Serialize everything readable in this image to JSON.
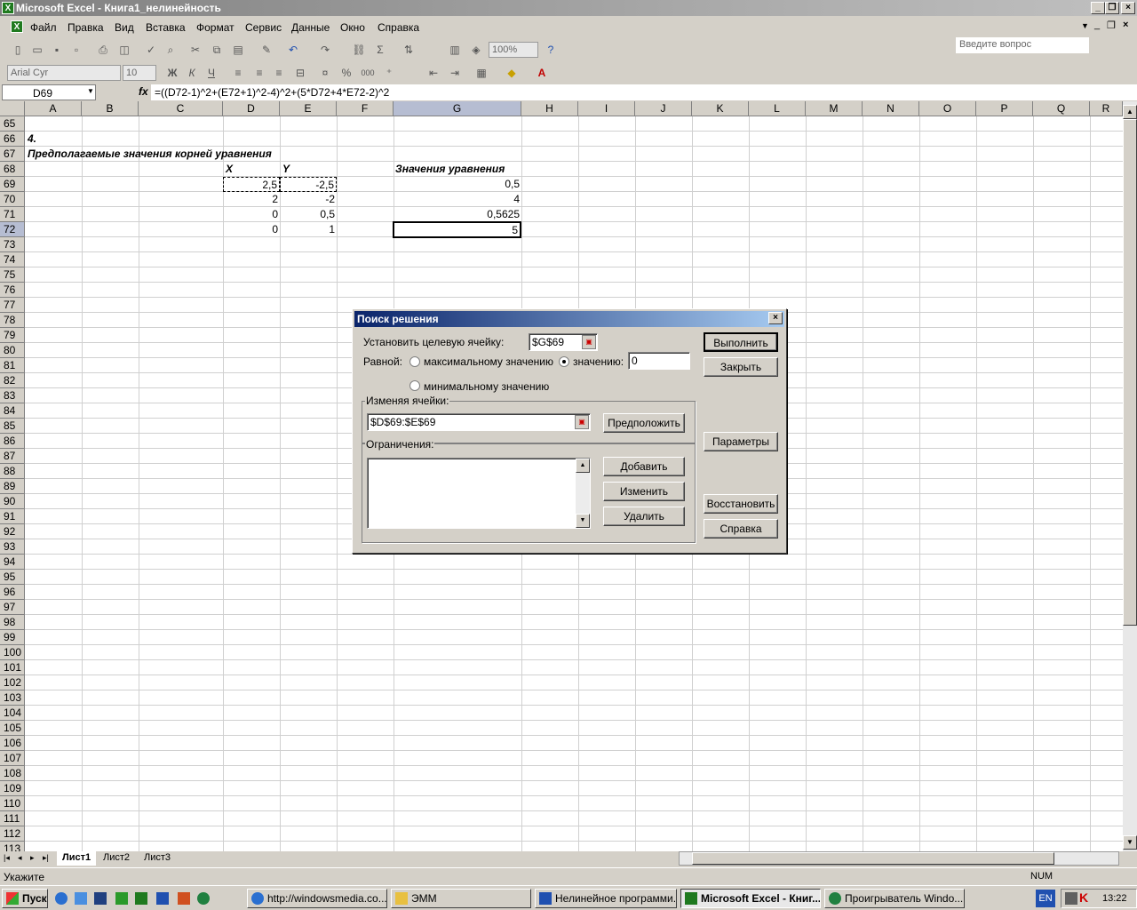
{
  "window": {
    "title": "Microsoft Excel - Книга1_нелинейность",
    "app_icon": "X"
  },
  "menu": {
    "items": [
      "Файл",
      "Правка",
      "Вид",
      "Вставка",
      "Формат",
      "Сервис",
      "Данные",
      "Окно",
      "Справка"
    ],
    "help_placeholder": "Введите вопрос"
  },
  "toolbar": {
    "zoom": "100%",
    "font_name": "Arial Cyr",
    "font_size": "10",
    "bold": "Ж",
    "italic": "К",
    "underline": "Ч"
  },
  "formula_bar": {
    "name_box": "D69",
    "fx": "fx",
    "formula": "=((D72-1)^2+(E72+1)^2-4)^2+(5*D72+4*E72-2)^2"
  },
  "columns": [
    "A",
    "B",
    "C",
    "D",
    "E",
    "F",
    "G",
    "H",
    "I",
    "J",
    "K",
    "L",
    "M",
    "N",
    "O",
    "P",
    "Q",
    "R"
  ],
  "rows": [
    "65",
    "66",
    "67",
    "68",
    "69",
    "70",
    "71",
    "72",
    "73",
    "74",
    "75",
    "76",
    "77",
    "78",
    "79",
    "80",
    "81",
    "82",
    "83",
    "84",
    "85",
    "86",
    "87",
    "88",
    "89",
    "90",
    "91",
    "92",
    "93",
    "94",
    "95",
    "96",
    "97",
    "98",
    "99",
    "100",
    "101",
    "102",
    "103",
    "104",
    "105",
    "106",
    "107",
    "108",
    "109",
    "110",
    "111",
    "112",
    "113"
  ],
  "cells": {
    "a66": "4.",
    "a67": "Предполагаемые значения корней уравнения",
    "d68": "X",
    "e68": "Y",
    "g68": "Значения уравнения",
    "d69": "2,5",
    "e69": "-2,5",
    "g69": "0,5",
    "d70": "2",
    "e70": "-2",
    "g70": "4",
    "d71": "0",
    "e71": "0,5",
    "g71": "0,5625",
    "d72": "0",
    "e72": "1",
    "g72": "5"
  },
  "sheets": [
    "Лист1",
    "Лист2",
    "Лист3"
  ],
  "status": {
    "mode": "Укажите",
    "num": "NUM"
  },
  "dialog": {
    "title": "Поиск решения",
    "target_label": "Установить целевую ячейку:",
    "target_value": "$G$69",
    "equal_label": "Равной:",
    "opt_max": "максимальному значению",
    "opt_value": "значению:",
    "value_input": "0",
    "opt_min": "минимальному значению",
    "changing_label": "Изменяя ячейки:",
    "changing_value": "$D$69:$E$69",
    "guess_btn": "Предположить",
    "constraints_label": "Ограничения:",
    "add_btn": "Добавить",
    "change_btn": "Изменить",
    "delete_btn": "Удалить",
    "run_btn": "Выполнить",
    "close_btn": "Закрыть",
    "params_btn": "Параметры",
    "reset_btn": "Восстановить",
    "help_btn": "Справка"
  },
  "taskbar": {
    "start": "Пуск",
    "tasks": [
      "http://windowsmedia.co...",
      "ЭММ",
      "Нелинейное программи...",
      "Microsoft Excel - Книг...",
      "Проигрыватель Windo..."
    ],
    "lang": "EN",
    "clock": "13:22"
  }
}
